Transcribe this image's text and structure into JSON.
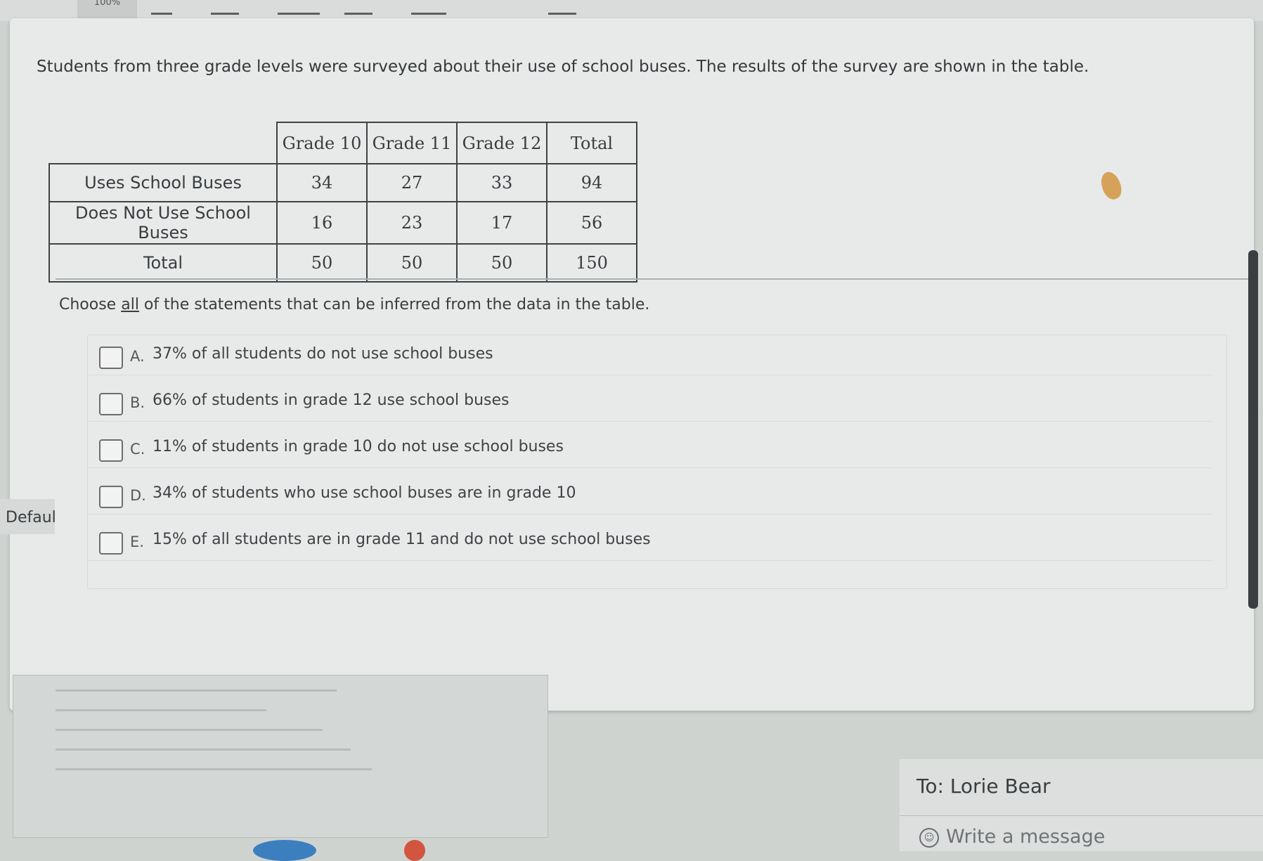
{
  "toolbar": {
    "zoom_label": "100%"
  },
  "question": {
    "text": "Students from three grade levels were surveyed about their use of school buses. The results of the survey are shown in the table."
  },
  "table": {
    "columns": [
      "Grade 10",
      "Grade 11",
      "Grade 12",
      "Total"
    ],
    "rows": [
      {
        "label": "Uses School Buses",
        "values": [
          "34",
          "27",
          "33",
          "94"
        ]
      },
      {
        "label": "Does Not Use School Buses",
        "values": [
          "16",
          "23",
          "17",
          "56"
        ]
      },
      {
        "label": "Total",
        "values": [
          "50",
          "50",
          "50",
          "150"
        ]
      }
    ]
  },
  "prompt": {
    "before": "Choose ",
    "emphasis": "all",
    "after": " of the statements that can be inferred from the data in the table."
  },
  "choices": [
    {
      "letter": "A.",
      "text": "37% of all students do not use school buses",
      "checked": false
    },
    {
      "letter": "B.",
      "text": "66% of students in grade 12 use school buses",
      "checked": false
    },
    {
      "letter": "C.",
      "text": "11% of students in grade 10 do not use school buses",
      "checked": false
    },
    {
      "letter": "D.",
      "text": "34% of students who use school buses are in grade 10",
      "checked": false
    },
    {
      "letter": "E.",
      "text": "15% of all students are in grade 11 and do not use school buses",
      "checked": false
    }
  ],
  "side_tab": {
    "label": "Defaul"
  },
  "side_fragment": "a",
  "message": {
    "to": "To: Lorie Bear",
    "placeholder": "Write a message"
  },
  "colors": {
    "panel": "#e8eae9",
    "background": "#cfd3d0",
    "text": "#3a3d40",
    "scrollbar": "#3b3e41"
  }
}
